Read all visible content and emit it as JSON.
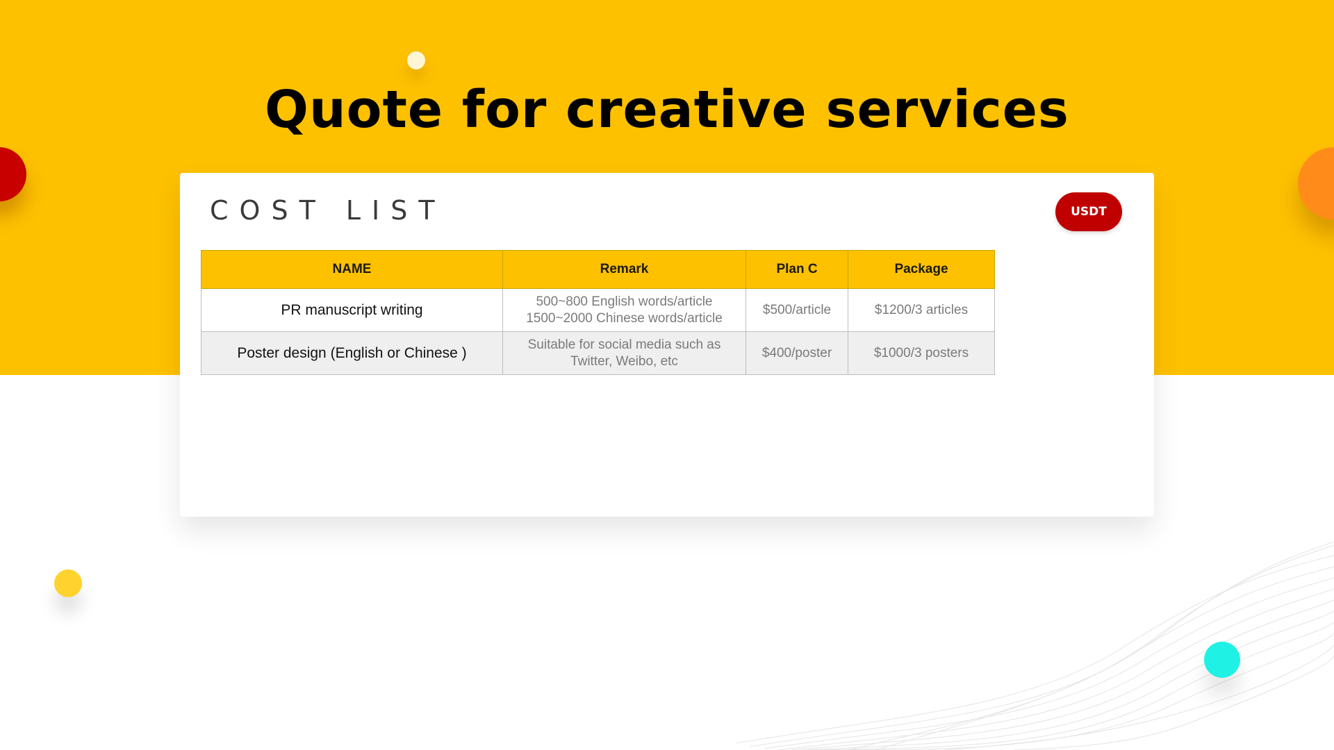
{
  "slide": {
    "title": "Quote for creative services"
  },
  "card": {
    "heading": "COST LIST",
    "currency_badge": "USDT"
  },
  "table": {
    "headers": [
      "NAME",
      "Remark",
      "Plan C",
      "Package"
    ],
    "rows": [
      {
        "name": "PR manuscript writing",
        "remark_lines": [
          "500~800  English words/article",
          "1500~2000  Chinese words/article"
        ],
        "plan_c": "$500/article",
        "package": "$1200/3  articles"
      },
      {
        "name": "Poster design (English or Chinese )",
        "remark_lines": [
          "Suitable for social media such as",
          "Twitter, Weibo, etc"
        ],
        "plan_c": "$400/poster",
        "package": "$1000/3  posters"
      }
    ]
  },
  "colors": {
    "band": "#FEC100",
    "badge": "#C00000",
    "header": "#FEC100"
  }
}
